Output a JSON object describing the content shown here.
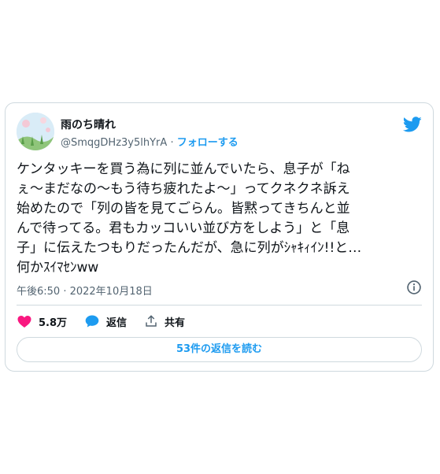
{
  "tweet": {
    "display_name": "雨のち晴れ",
    "handle": "@SmqgDHz3y5lhYrA",
    "separator": "·",
    "follow_label": "フォローする",
    "text": "ケンタッキーを買う為に列に並んでいたら、息子が「ね\nぇ〜まだなの〜もう待ち疲れたよ〜」ってクネクネ訴え\n始めたので「列の皆を見てごらん。皆黙ってきちんと並\nんで待ってる。君もカッコいい並び方をしよう」と「息\n子」に伝えたつもりだったんだが、急に列がｼｬｷｨｲﾝ!!と…\n何かｽｲﾏｾﾝww",
    "timestamp": "午後6:50 · 2022年10月18日",
    "likes": "5.8万",
    "reply_label": "返信",
    "share_label": "共有",
    "read_replies_label": "53件の返信を読む"
  },
  "icons": {
    "brand": "twitter-bird-icon",
    "info": "info-icon",
    "like": "heart-icon",
    "reply": "speech-bubble-icon",
    "share": "share-icon"
  },
  "colors": {
    "accent": "#1d9bf0",
    "like": "#f91880",
    "muted": "#536471",
    "border": "#cfd9de"
  }
}
